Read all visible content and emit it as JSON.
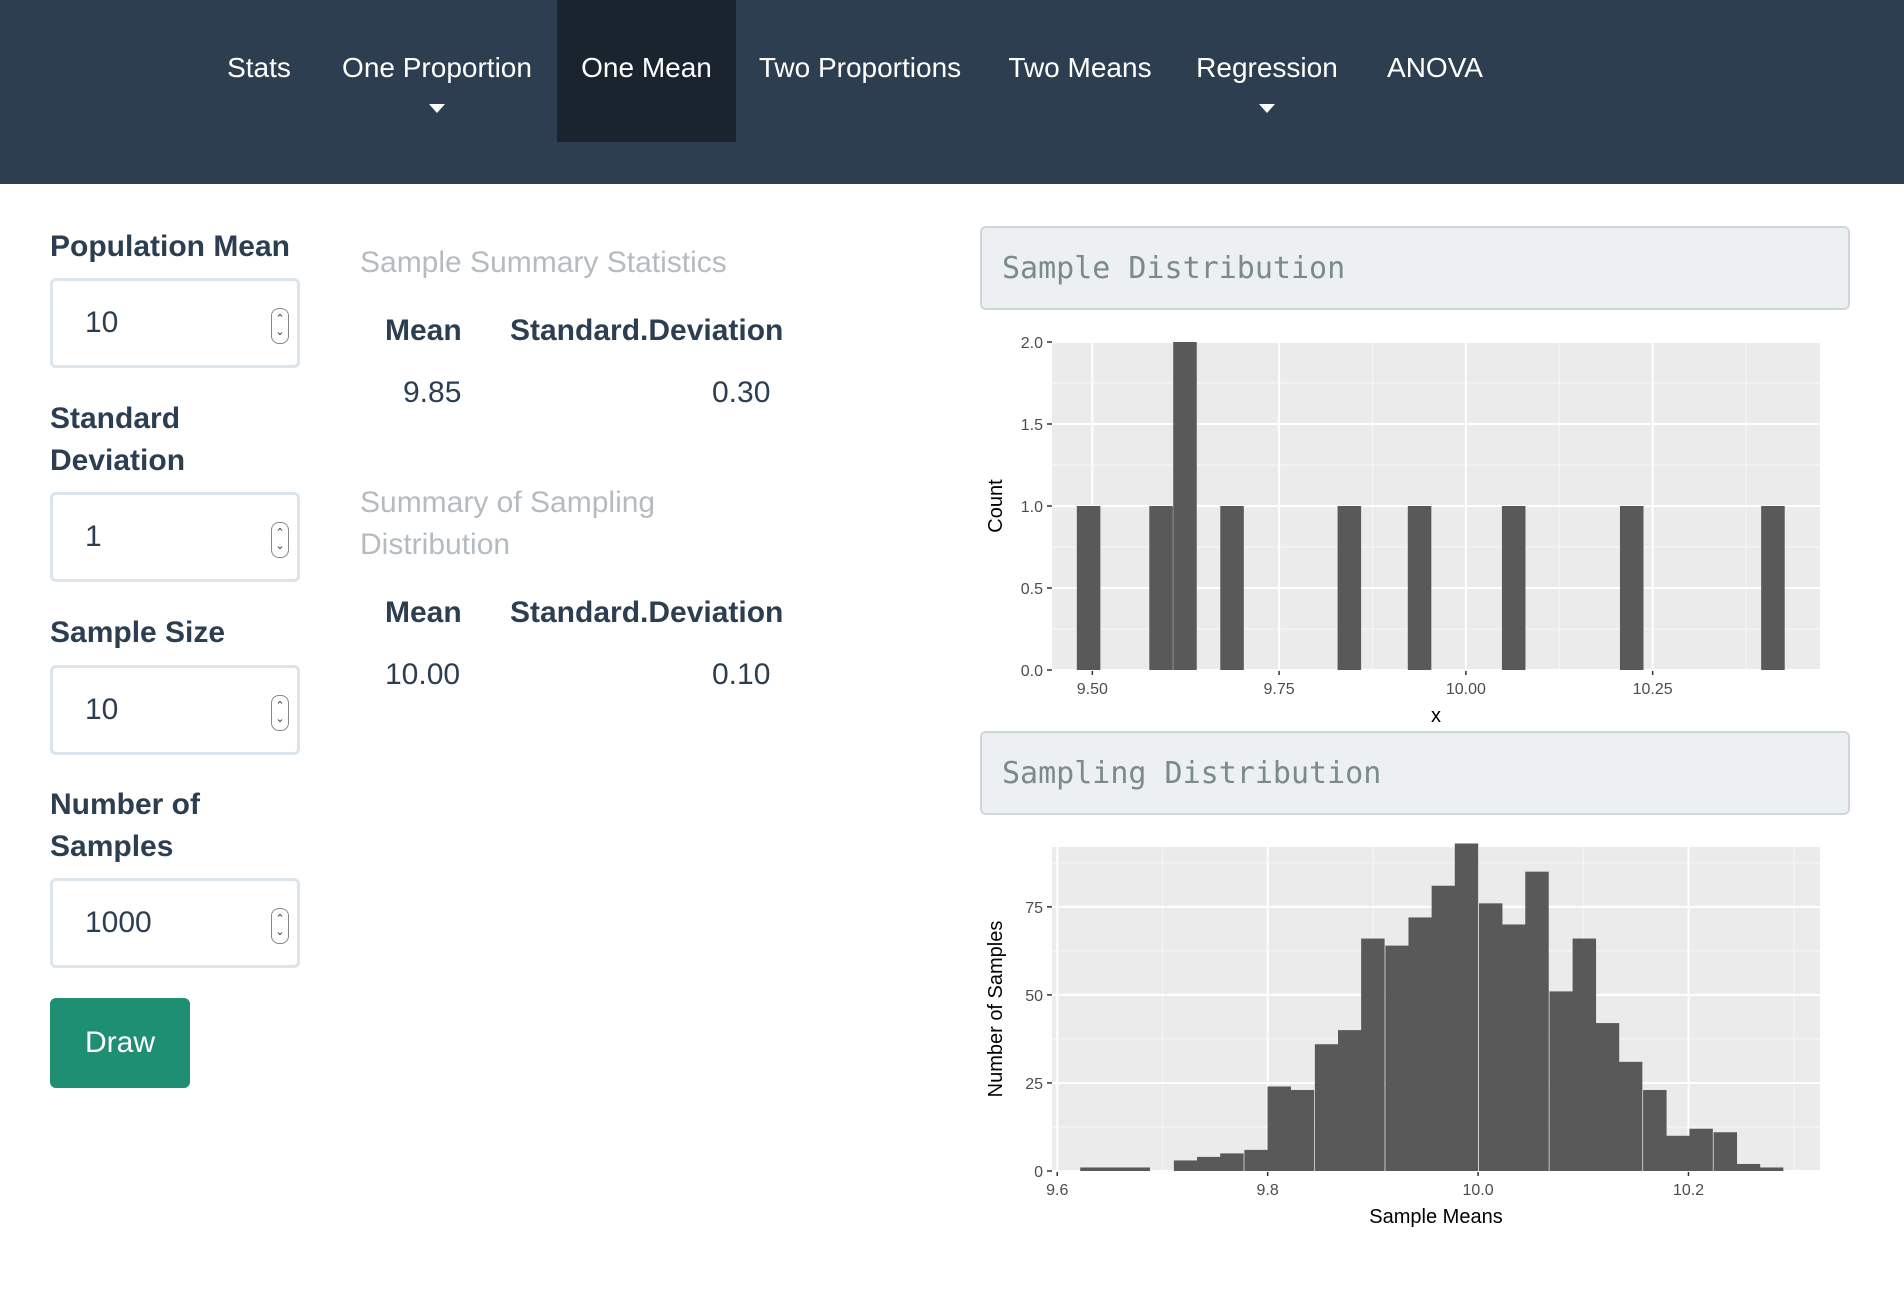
{
  "nav": {
    "items": [
      {
        "label": "Stats",
        "dropdown": false,
        "active": false
      },
      {
        "label": "One Proportion",
        "dropdown": true,
        "active": false
      },
      {
        "label": "One Mean",
        "dropdown": false,
        "active": true
      },
      {
        "label": "Two Proportions",
        "dropdown": false,
        "active": false
      },
      {
        "label": "Two Means",
        "dropdown": false,
        "active": false
      },
      {
        "label": "Regression",
        "dropdown": true,
        "active": false
      },
      {
        "label": "ANOVA",
        "dropdown": false,
        "active": false
      }
    ]
  },
  "sidebar": {
    "population_mean": {
      "label": "Population Mean",
      "value": "10"
    },
    "standard_deviation": {
      "label_line1": "Standard",
      "label_line2": "Deviation",
      "value": "1"
    },
    "sample_size": {
      "label": "Sample Size",
      "value": "10"
    },
    "number_of_samples": {
      "label_line1": "Number of",
      "label_line2": "Samples",
      "value": "1000"
    },
    "draw_label": "Draw"
  },
  "sample_summary": {
    "title": "Sample Summary Statistics",
    "headers": [
      "Mean",
      "Standard.Deviation"
    ],
    "values": [
      "9.85",
      "0.30"
    ]
  },
  "sampling_summary": {
    "title_line1": "Summary of Sampling",
    "title_line2": "Distribution",
    "headers": [
      "Mean",
      "Standard.Deviation"
    ],
    "values": [
      "10.00",
      "0.10"
    ]
  },
  "panels": {
    "sample_distribution": "Sample Distribution",
    "sampling_distribution": "Sampling Distribution"
  },
  "chart_data": [
    {
      "type": "bar",
      "xlabel": "x",
      "ylabel": "Count",
      "xlim": [
        9.446,
        10.474
      ],
      "ylim": [
        0,
        2.0
      ],
      "xticks": [
        "9.50",
        "9.75",
        "10.00",
        "10.25"
      ],
      "yticks": [
        "0.0",
        "0.5",
        "1.0",
        "1.5",
        "2.0"
      ],
      "bin_width": 0.0315,
      "bins": [
        {
          "x": 9.495,
          "count": 1
        },
        {
          "x": 9.592,
          "count": 1
        },
        {
          "x": 9.624,
          "count": 2
        },
        {
          "x": 9.687,
          "count": 1
        },
        {
          "x": 9.844,
          "count": 1
        },
        {
          "x": 9.938,
          "count": 1
        },
        {
          "x": 10.064,
          "count": 1
        },
        {
          "x": 10.222,
          "count": 1
        },
        {
          "x": 10.411,
          "count": 1
        }
      ],
      "grid": true
    },
    {
      "type": "bar",
      "xlabel": "Sample Means",
      "ylabel": "Number of Samples",
      "xlim": [
        9.595,
        10.325
      ],
      "ylim": [
        0,
        92
      ],
      "xticks": [
        "9.6",
        "9.8",
        "10.0",
        "10.2"
      ],
      "yticks": [
        "0",
        "25",
        "50",
        "75"
      ],
      "bin_width": 0.0223,
      "bins": [
        {
          "x": 9.633,
          "count": 1
        },
        {
          "x": 9.655,
          "count": 1
        },
        {
          "x": 9.677,
          "count": 1
        },
        {
          "x": 9.722,
          "count": 3
        },
        {
          "x": 9.744,
          "count": 4
        },
        {
          "x": 9.766,
          "count": 5
        },
        {
          "x": 9.789,
          "count": 6
        },
        {
          "x": 9.811,
          "count": 24
        },
        {
          "x": 9.833,
          "count": 23
        },
        {
          "x": 9.856,
          "count": 36
        },
        {
          "x": 9.878,
          "count": 40
        },
        {
          "x": 9.9,
          "count": 66
        },
        {
          "x": 9.923,
          "count": 64
        },
        {
          "x": 9.945,
          "count": 72
        },
        {
          "x": 9.967,
          "count": 81
        },
        {
          "x": 9.989,
          "count": 93
        },
        {
          "x": 10.012,
          "count": 76
        },
        {
          "x": 10.034,
          "count": 70
        },
        {
          "x": 10.056,
          "count": 85
        },
        {
          "x": 10.079,
          "count": 51
        },
        {
          "x": 10.101,
          "count": 66
        },
        {
          "x": 10.123,
          "count": 42
        },
        {
          "x": 10.145,
          "count": 31
        },
        {
          "x": 10.168,
          "count": 23
        },
        {
          "x": 10.19,
          "count": 10
        },
        {
          "x": 10.212,
          "count": 12
        },
        {
          "x": 10.235,
          "count": 11
        },
        {
          "x": 10.257,
          "count": 2
        },
        {
          "x": 10.279,
          "count": 1
        }
      ],
      "grid": true
    }
  ]
}
